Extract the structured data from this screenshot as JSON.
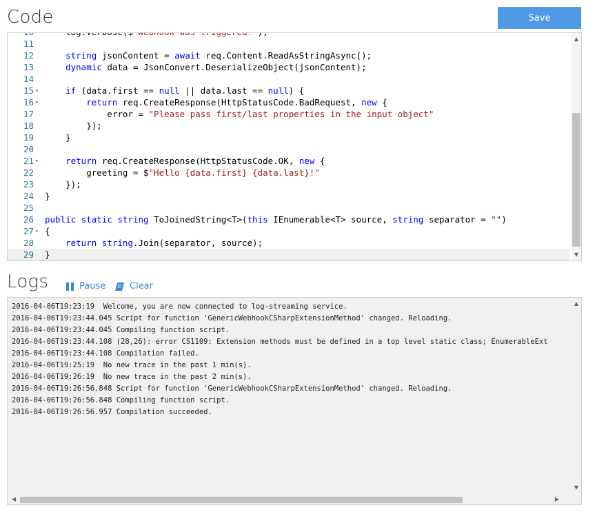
{
  "code_section": {
    "title": "Code",
    "save_label": "Save",
    "lines": [
      {
        "n": "10",
        "fold": "",
        "text": "    log.Verbose($\"Webhook was triggered!\");"
      },
      {
        "n": "11",
        "fold": "",
        "text": ""
      },
      {
        "n": "12",
        "fold": "",
        "text": "    string jsonContent = await req.Content.ReadAsStringAsync();"
      },
      {
        "n": "13",
        "fold": "",
        "text": "    dynamic data = JsonConvert.DeserializeObject(jsonContent);"
      },
      {
        "n": "14",
        "fold": "",
        "text": ""
      },
      {
        "n": "15",
        "fold": "▾",
        "text": "    if (data.first == null || data.last == null) {"
      },
      {
        "n": "16",
        "fold": "▾",
        "text": "        return req.CreateResponse(HttpStatusCode.BadRequest, new {"
      },
      {
        "n": "17",
        "fold": "",
        "text": "            error = \"Please pass first/last properties in the input object\""
      },
      {
        "n": "18",
        "fold": "",
        "text": "        });"
      },
      {
        "n": "19",
        "fold": "",
        "text": "    }"
      },
      {
        "n": "20",
        "fold": "",
        "text": ""
      },
      {
        "n": "21",
        "fold": "▾",
        "text": "    return req.CreateResponse(HttpStatusCode.OK, new {"
      },
      {
        "n": "22",
        "fold": "",
        "text": "        greeting = $\"Hello {data.first} {data.last}!\""
      },
      {
        "n": "23",
        "fold": "",
        "text": "    });"
      },
      {
        "n": "24",
        "fold": "",
        "text": "}"
      },
      {
        "n": "25",
        "fold": "",
        "text": ""
      },
      {
        "n": "26",
        "fold": "",
        "text": "public static string ToJoinedString<T>(this IEnumerable<T> source, string separator = \"\")"
      },
      {
        "n": "27",
        "fold": "▾",
        "text": "{"
      },
      {
        "n": "28",
        "fold": "",
        "text": "    return string.Join(separator, source);"
      },
      {
        "n": "29",
        "fold": "",
        "text": "}"
      }
    ]
  },
  "logs_section": {
    "title": "Logs",
    "pause_label": "Pause",
    "clear_label": "Clear",
    "entries": [
      "2016-04-06T19:23:19  Welcome, you are now connected to log-streaming service.",
      "2016-04-06T19:23:44.045 Script for function 'GenericWebhookCSharpExtensionMethod' changed. Reloading.",
      "2016-04-06T19:23:44.045 Compiling function script.",
      "2016-04-06T19:23:44.108 (28,26): error CS1109: Extension methods must be defined in a top level static class; EnumerableExt",
      "2016-04-06T19:23:44.108 Compilation failed.",
      "2016-04-06T19:25:19  No new trace in the past 1 min(s).",
      "2016-04-06T19:26:19  No new trace in the past 2 min(s).",
      "2016-04-06T19:26:56.848 Script for function 'GenericWebhookCSharpExtensionMethod' changed. Reloading.",
      "2016-04-06T19:26:56.848 Compiling function script.",
      "2016-04-06T19:26:56.957 Compilation succeeded."
    ]
  },
  "colors": {
    "save_button": "#4e9ae6",
    "link_blue": "#3a87d6",
    "keyword": "#0000ff",
    "string": "#a31515",
    "line_number": "#237893"
  },
  "icons": {
    "pause": "pause-icon",
    "clear": "clear-icon"
  }
}
